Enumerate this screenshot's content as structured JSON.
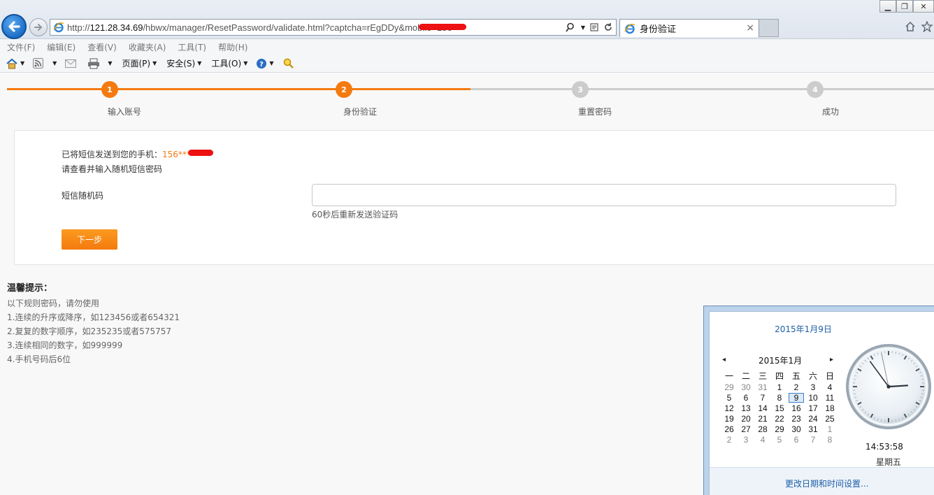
{
  "browser": {
    "url_prefix": "http://",
    "url_host": "121.28.34.69",
    "url_path": "/hbwx/manager/ResetPassword/validate.html?captcha=rEgDDy&mobile=156",
    "tab_title": "身份验证",
    "tab_close": "×",
    "window_buttons": {
      "minimize": "▁",
      "restore": "❐",
      "close": "✕"
    }
  },
  "menubar": [
    "文件(F)",
    "编辑(E)",
    "查看(V)",
    "收藏夹(A)",
    "工具(T)",
    "帮助(H)"
  ],
  "commandbar": {
    "page": "页面(P)",
    "safety": "安全(S)",
    "tools": "工具(O)"
  },
  "steps": [
    {
      "num": "1",
      "label": "输入账号",
      "state": "done"
    },
    {
      "num": "2",
      "label": "身份验证",
      "state": "done"
    },
    {
      "num": "3",
      "label": "重置密码",
      "state": "todo"
    },
    {
      "num": "4",
      "label": "成功",
      "state": "todo"
    }
  ],
  "progress": {
    "fraction": 0.5
  },
  "form": {
    "sent_prefix": "已将短信发送到您的手机：",
    "sent_phone": "156***",
    "hint": "请查看并输入随机短信密码",
    "field_label": "短信随机码",
    "code_value": "",
    "resend": "60秒后重新发送验证码",
    "next_label": "下一步"
  },
  "tips": {
    "title": "温馨提示：",
    "lines": [
      "以下规则密码，请勿使用",
      "1.连续的升序或降序，如123456或者654321",
      "2.复复的数字顺序，如235235或者575757",
      "3.连续相同的数字，如999999",
      "4.手机号码后6位"
    ]
  },
  "calendar": {
    "date_link": "2015年1月9日",
    "month_label": "2015年1月",
    "prev": "◂",
    "next": "▸",
    "weekdays": [
      "一",
      "二",
      "三",
      "四",
      "五",
      "六",
      "日"
    ],
    "weeks": [
      [
        "29",
        "30",
        "31",
        "1",
        "2",
        "3",
        "4"
      ],
      [
        "5",
        "6",
        "7",
        "8",
        "9",
        "10",
        "11"
      ],
      [
        "12",
        "13",
        "14",
        "15",
        "16",
        "17",
        "18"
      ],
      [
        "19",
        "20",
        "21",
        "22",
        "23",
        "24",
        "25"
      ],
      [
        "26",
        "27",
        "28",
        "29",
        "30",
        "31",
        "1"
      ],
      [
        "2",
        "3",
        "4",
        "5",
        "6",
        "7",
        "8"
      ]
    ],
    "selected_day": "9",
    "time": "14:53:58",
    "weekday_name": "星期五",
    "footer_link": "更改日期和时间设置..."
  },
  "colors": {
    "accent": "#f47a0f",
    "inactive": "#cccccc",
    "link": "#1c5fa8"
  }
}
